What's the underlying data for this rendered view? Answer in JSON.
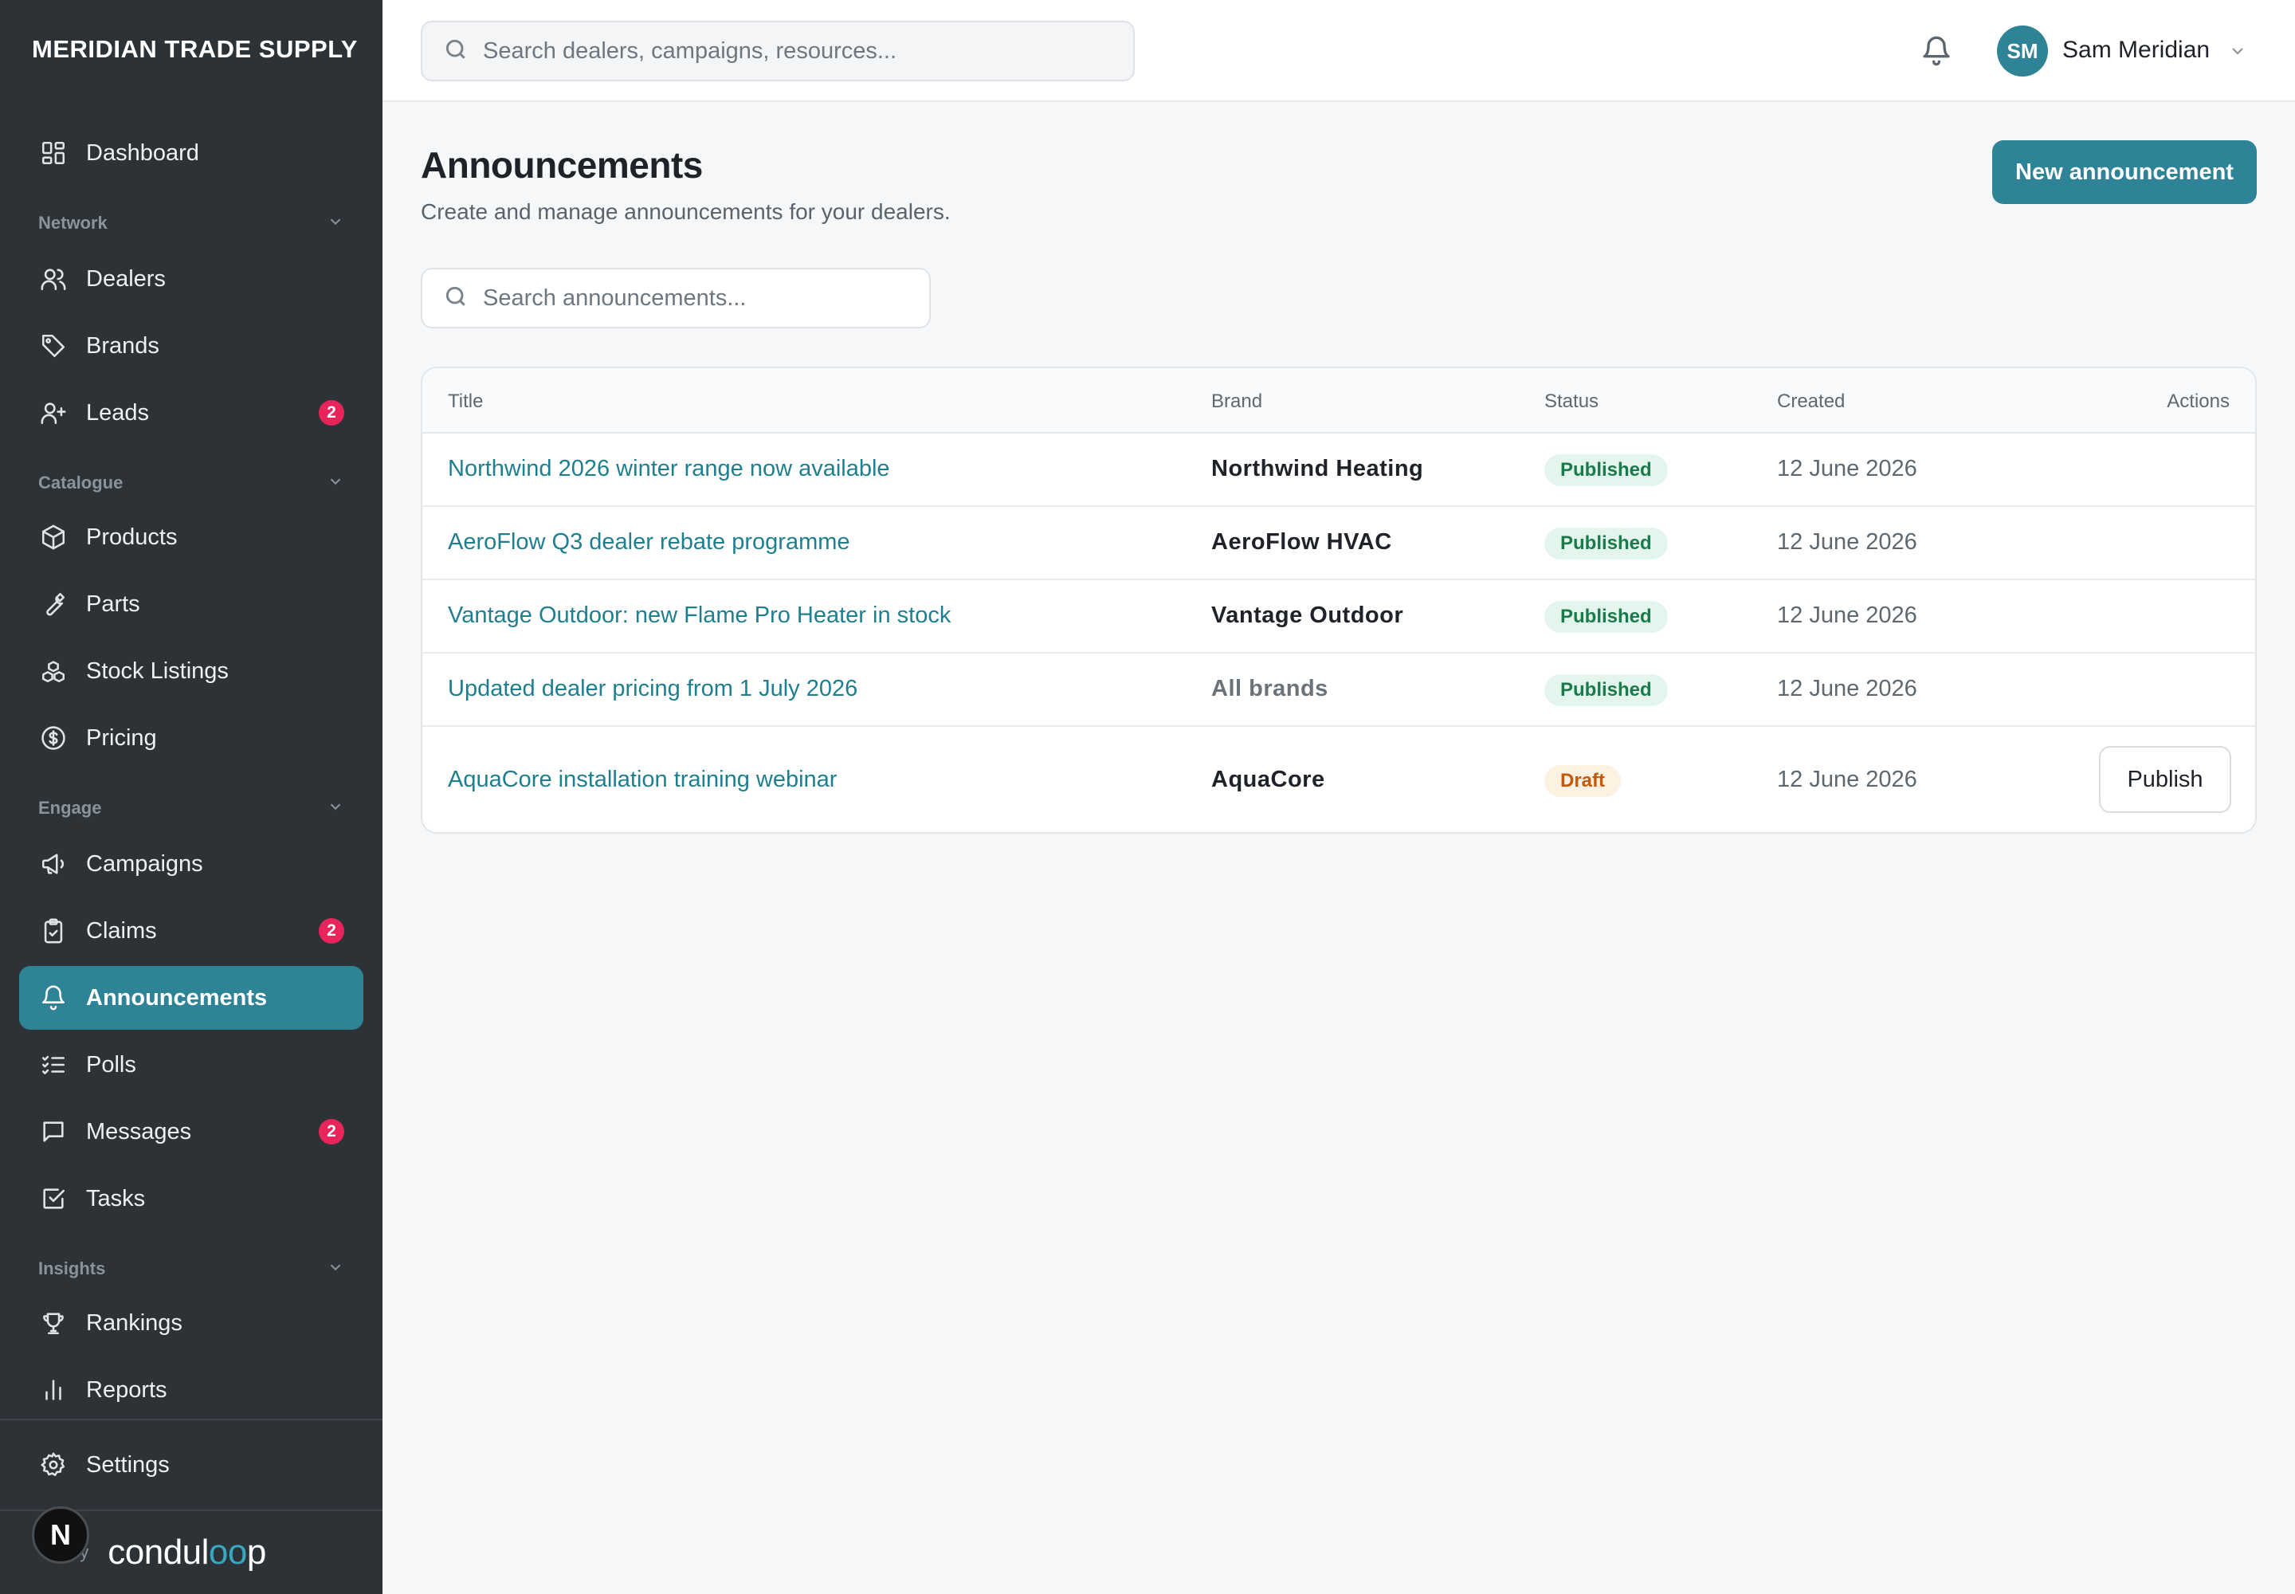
{
  "sidebar": {
    "brand": "MERIDIAN TRADE SUPPLY",
    "dashboard": "Dashboard",
    "sections": {
      "network": "Network",
      "catalogue": "Catalogue",
      "engage": "Engage",
      "insights": "Insights"
    },
    "items": {
      "dealers": "Dealers",
      "brands": "Brands",
      "leads": "Leads",
      "leads_badge": "2",
      "products": "Products",
      "parts": "Parts",
      "stock_listings": "Stock Listings",
      "pricing": "Pricing",
      "campaigns": "Campaigns",
      "claims": "Claims",
      "claims_badge": "2",
      "announcements": "Announcements",
      "polls": "Polls",
      "messages": "Messages",
      "messages_badge": "2",
      "tasks": "Tasks",
      "rankings": "Rankings",
      "reports": "Reports",
      "settings": "Settings"
    },
    "footer": {
      "powered_by": "by",
      "logo_start": "condul",
      "logo_oo": "oo",
      "logo_end": "p",
      "n_avatar": "N"
    },
    "active_color": "#2e8396"
  },
  "topbar": {
    "search_placeholder": "Search dealers, campaigns, resources...",
    "user_initials": "SM",
    "user_name": "Sam Meridian"
  },
  "main": {
    "title": "Announcements",
    "subtitle": "Create and manage announcements for your dealers.",
    "new_button": "New announcement",
    "search_placeholder": "Search announcements...",
    "table": {
      "headers": {
        "title": "Title",
        "brand": "Brand",
        "status": "Status",
        "created": "Created",
        "actions": "Actions"
      },
      "rows": [
        {
          "title": "Northwind 2026 winter range now available",
          "brand": "Northwind Heating",
          "status": "Published",
          "created": "12 June 2026"
        },
        {
          "title": "AeroFlow Q3 dealer rebate programme",
          "brand": "AeroFlow HVAC",
          "status": "Published",
          "created": "12 June 2026"
        },
        {
          "title": "Vantage Outdoor: new Flame Pro Heater in stock",
          "brand": "Vantage Outdoor",
          "status": "Published",
          "created": "12 June 2026"
        },
        {
          "title": "Updated dealer pricing from 1 July 2026",
          "brand": "All brands",
          "status": "Published",
          "created": "12 June 2026"
        },
        {
          "title": "AquaCore installation training webinar",
          "brand": "AquaCore",
          "status": "Draft",
          "created": "12 June 2026",
          "action": "Publish"
        }
      ]
    }
  }
}
